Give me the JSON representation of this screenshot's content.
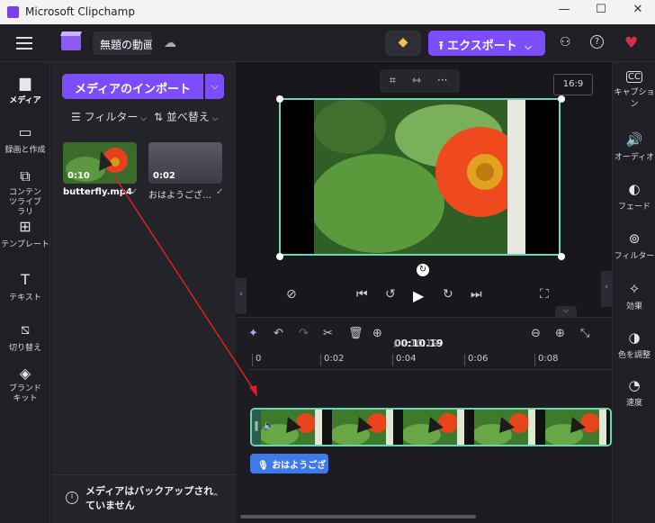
{
  "window": {
    "title": "Microsoft Clipchamp",
    "minimize": "—",
    "maximize": "☐",
    "close": "✕"
  },
  "header": {
    "project_title": "無題の動画",
    "export_label": "エクスポート",
    "export_chevron": "⌵",
    "icons": [
      "menu-icon",
      "clipchamp-logo",
      "cloud-off-icon",
      "premium-diamond-icon",
      "share-people-icon",
      "help-icon",
      "heart-icon"
    ]
  },
  "left_rail": {
    "items": [
      {
        "label": "メディア",
        "icon": "folder-icon"
      },
      {
        "label": "録画と作成",
        "icon": "camera-icon"
      },
      {
        "label": "コンテンツライブラリ",
        "icon": "library-icon"
      },
      {
        "label": "テンプレート",
        "icon": "template-icon"
      },
      {
        "label": "テキスト",
        "icon": "text-icon"
      },
      {
        "label": "切り替え",
        "icon": "transition-icon"
      },
      {
        "label": "ブランド キット",
        "icon": "brand-kit-icon"
      }
    ]
  },
  "media_panel": {
    "import_label": "メディアのインポート",
    "filter_label": "フィルター",
    "sort_label": "並べ替え",
    "items": [
      {
        "name": "butterfly.mp4",
        "duration": "0:10"
      },
      {
        "name": "おはようござ…",
        "duration": "0:02"
      }
    ],
    "backup_message": "メディアはバックアップされていません"
  },
  "preview": {
    "aspect_ratio": "16:9",
    "tool_icons": [
      "crop-icon",
      "fit-icon",
      "more-icon"
    ]
  },
  "timeline": {
    "current_time": "00:10.19",
    "separator": " / ",
    "total_time": "00:10.19",
    "ruler_ticks": [
      "0",
      "0:02",
      "0:04",
      "0:06",
      "0:08"
    ],
    "audio_clip_label": "おはようござ"
  },
  "right_rail": {
    "items": [
      {
        "label": "キャプション",
        "icon": "captions-icon"
      },
      {
        "label": "オーディオ",
        "icon": "audio-icon"
      },
      {
        "label": "フェード",
        "icon": "fade-icon"
      },
      {
        "label": "フィルター",
        "icon": "filter-icon"
      },
      {
        "label": "効果",
        "icon": "effects-icon"
      },
      {
        "label": "色を調整",
        "icon": "color-adjust-icon"
      },
      {
        "label": "速度",
        "icon": "speed-icon"
      }
    ]
  },
  "colors": {
    "accent": "#7c4dff",
    "selection": "#6fd4b3",
    "audio_clip": "#3f7be8",
    "annotation_arrow": "#e02020"
  }
}
